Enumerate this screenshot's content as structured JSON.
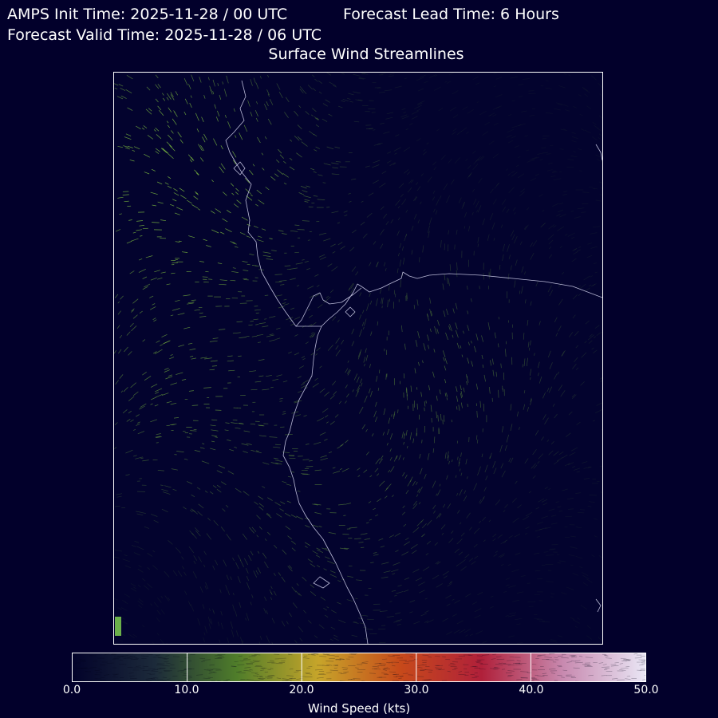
{
  "header": {
    "init_time": "AMPS Init Time: 2025-11-28 / 00 UTC",
    "lead_time": "Forecast Lead Time: 6 Hours",
    "valid_time": "Forecast Valid Time: 2025-11-28 / 06 UTC"
  },
  "map": {
    "title": "Surface Wind Streamlines",
    "background_color": "#03032e",
    "coastline_color": "#b9b9d6",
    "streak_color": "#7fbf3f"
  },
  "colorbar": {
    "label": "Wind Speed (kts)",
    "ticks": [
      "0.0",
      "10.0",
      "20.0",
      "30.0",
      "40.0",
      "50.0"
    ],
    "tick_values": [
      0,
      10,
      20,
      30,
      40,
      50
    ],
    "range": [
      0,
      50
    ],
    "colors": [
      "#02022a",
      "#1c2a3a",
      "#4f7d2a",
      "#c7a52a",
      "#c74a1a",
      "#b0203a",
      "#c88ab0",
      "#e9e6f5"
    ]
  }
}
